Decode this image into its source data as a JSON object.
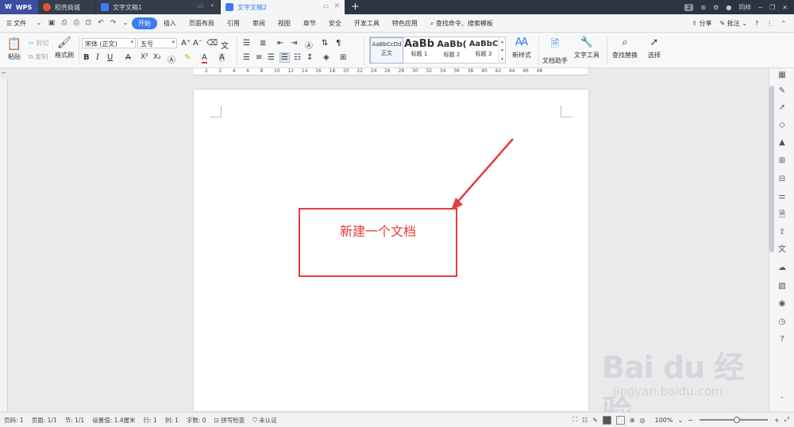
{
  "tabs": [
    {
      "label": "WPS",
      "icon": "wps-logo-icon"
    },
    {
      "label": "稻壳商城",
      "icon": "docer-store-icon"
    },
    {
      "label": "文字文稿1",
      "icon": "writer-doc-icon"
    },
    {
      "label": "文字文稿2",
      "icon": "writer-doc-icon",
      "active": true
    }
  ],
  "title_right": {
    "badge": "2",
    "user": "同样"
  },
  "menu": {
    "file": "文件",
    "items": [
      "开始",
      "插入",
      "页面布局",
      "引用",
      "审阅",
      "视图",
      "章节",
      "安全",
      "开发工具",
      "特色应用"
    ],
    "active": "开始",
    "search": "查找命令、搜索模板",
    "share": "分享",
    "comment": "批注"
  },
  "ribbon": {
    "paste": "粘贴",
    "cut": "剪切",
    "copy": "复制",
    "format_painter": "格式刷",
    "font_name": "宋体 (正文)",
    "font_size": "五号",
    "styles": [
      {
        "sample": "AaBbCcDd",
        "name": "正文"
      },
      {
        "sample": "AaBb",
        "name": "标题 1"
      },
      {
        "sample": "AaBb(",
        "name": "标题 2"
      },
      {
        "sample": "AaBbC",
        "name": "标题 3"
      }
    ],
    "new_style": "新样式",
    "doc_assistant": "文档助手",
    "text_tools": "文字工具",
    "find_replace": "查找替换",
    "select": "选择"
  },
  "ruler_labels": [
    "2",
    "2",
    "4",
    "6",
    "8",
    "10",
    "12",
    "14",
    "16",
    "18",
    "20",
    "22",
    "24",
    "26",
    "28",
    "30",
    "32",
    "34",
    "36",
    "38",
    "40",
    "42",
    "44",
    "46",
    "48"
  ],
  "document": {
    "text": "新建一个文档",
    "annotation_color": "#e63b3b"
  },
  "status": {
    "page_num": "页码: 1",
    "pages": "页面: 1/1",
    "section": "节: 1/1",
    "setting": "设置值: 1.4厘米",
    "row": "行: 1",
    "col": "列: 1",
    "words": "字数: 0",
    "spell": "拼写检查",
    "cert": "未认证",
    "zoom": "100%",
    "zoom_level": 0.55
  },
  "watermark": {
    "brand": "Bai du 经验",
    "url": "jingyan.baidu.com"
  }
}
